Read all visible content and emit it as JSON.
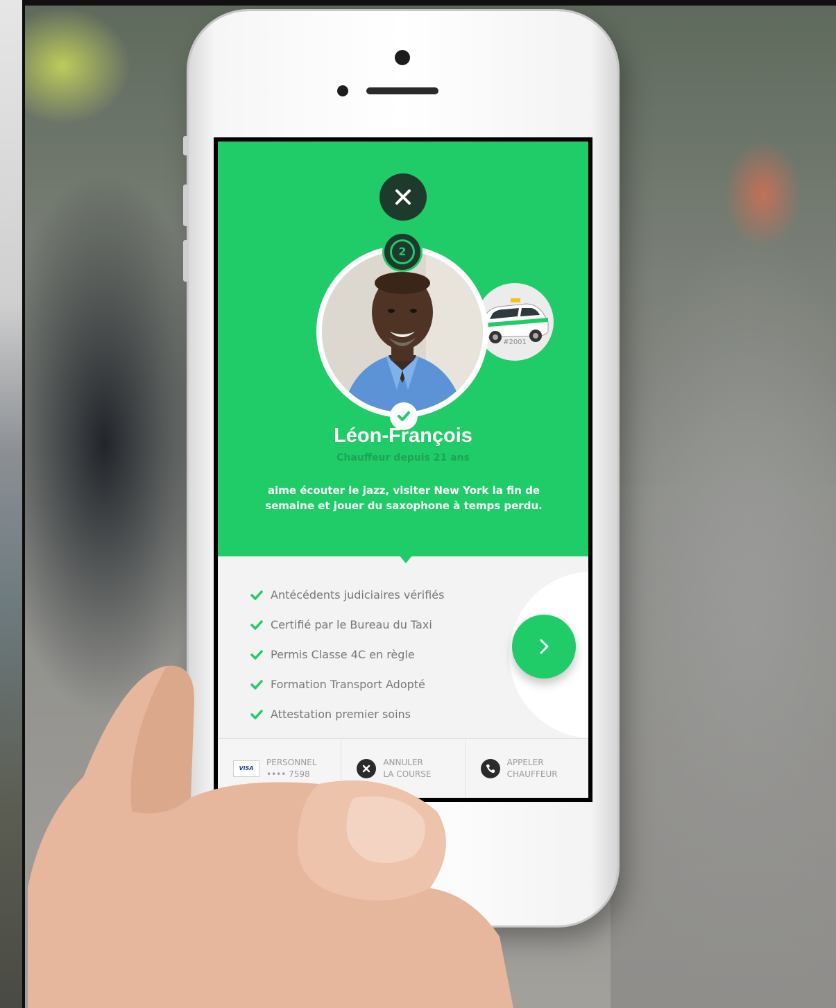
{
  "driver": {
    "name": "Léon-François",
    "subtitle": "Chauffeur depuis 21 ans",
    "bio": "aime écouter le jazz, visiter New York la fin de semaine et jouer du saxophone à temps perdu.",
    "rank": "2",
    "taxi_number": "#2001"
  },
  "qualifications": [
    "Antécédents judiciaires vérifiés",
    "Certifié par le Bureau du Taxi",
    "Permis Classe 4C en règle",
    "Formation Transport Adopté",
    "Attestation premier soins"
  ],
  "bottom_bar": {
    "payment": {
      "card_brand": "VISA",
      "line1": "PERSONNEL",
      "line2": "•••• 7598"
    },
    "cancel": {
      "line1": "ANNULER",
      "line2": "LA COURSE"
    },
    "call": {
      "line1": "APPELER",
      "line2": "CHAUFFEUR"
    }
  },
  "icons": {
    "close": "close-icon",
    "rank": "rank-badge-icon",
    "verified": "check-icon",
    "next": "chevron-right-icon",
    "card": "credit-card-icon",
    "cancel": "cancel-icon",
    "phone": "phone-icon"
  },
  "colors": {
    "primary_green": "#20cc68",
    "dark_green": "#1e3a2c",
    "subtitle_green": "#1ea356"
  }
}
